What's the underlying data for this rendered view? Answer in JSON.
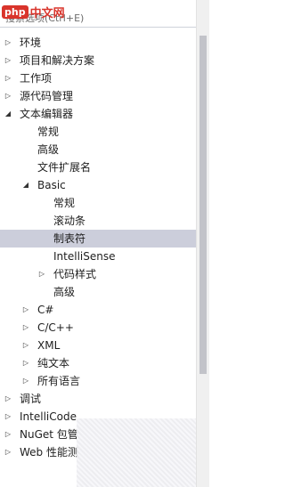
{
  "search": {
    "placeholder": "搜索选项(Ctrl+E)"
  },
  "watermark": {
    "badge": "php",
    "text": "中文网"
  },
  "tree": [
    {
      "label": "环境",
      "level": 0,
      "expander": "collapsed"
    },
    {
      "label": "项目和解决方案",
      "level": 0,
      "expander": "collapsed"
    },
    {
      "label": "工作项",
      "level": 0,
      "expander": "collapsed"
    },
    {
      "label": "源代码管理",
      "level": 0,
      "expander": "collapsed"
    },
    {
      "label": "文本编辑器",
      "level": 0,
      "expander": "expanded"
    },
    {
      "label": "常规",
      "level": 1,
      "expander": "none"
    },
    {
      "label": "高级",
      "level": 1,
      "expander": "none"
    },
    {
      "label": "文件扩展名",
      "level": 1,
      "expander": "none"
    },
    {
      "label": "Basic",
      "level": 1,
      "expander": "expanded"
    },
    {
      "label": "常规",
      "level": 2,
      "expander": "none"
    },
    {
      "label": "滚动条",
      "level": 2,
      "expander": "none"
    },
    {
      "label": "制表符",
      "level": 2,
      "expander": "none",
      "selected": true
    },
    {
      "label": "IntelliSense",
      "level": 2,
      "expander": "none"
    },
    {
      "label": "代码样式",
      "level": 2,
      "expander": "collapsed"
    },
    {
      "label": "高级",
      "level": 2,
      "expander": "none"
    },
    {
      "label": "C#",
      "level": 1,
      "expander": "collapsed"
    },
    {
      "label": "C/C++",
      "level": 1,
      "expander": "collapsed"
    },
    {
      "label": "XML",
      "level": 1,
      "expander": "collapsed"
    },
    {
      "label": "纯文本",
      "level": 1,
      "expander": "collapsed"
    },
    {
      "label": "所有语言",
      "level": 1,
      "expander": "collapsed"
    },
    {
      "label": "调试",
      "level": 0,
      "expander": "collapsed"
    },
    {
      "label": "IntelliCode",
      "level": 0,
      "expander": "collapsed"
    },
    {
      "label": "NuGet 包管",
      "level": 0,
      "expander": "collapsed"
    },
    {
      "label": "Web 性能测",
      "level": 0,
      "expander": "collapsed"
    }
  ]
}
